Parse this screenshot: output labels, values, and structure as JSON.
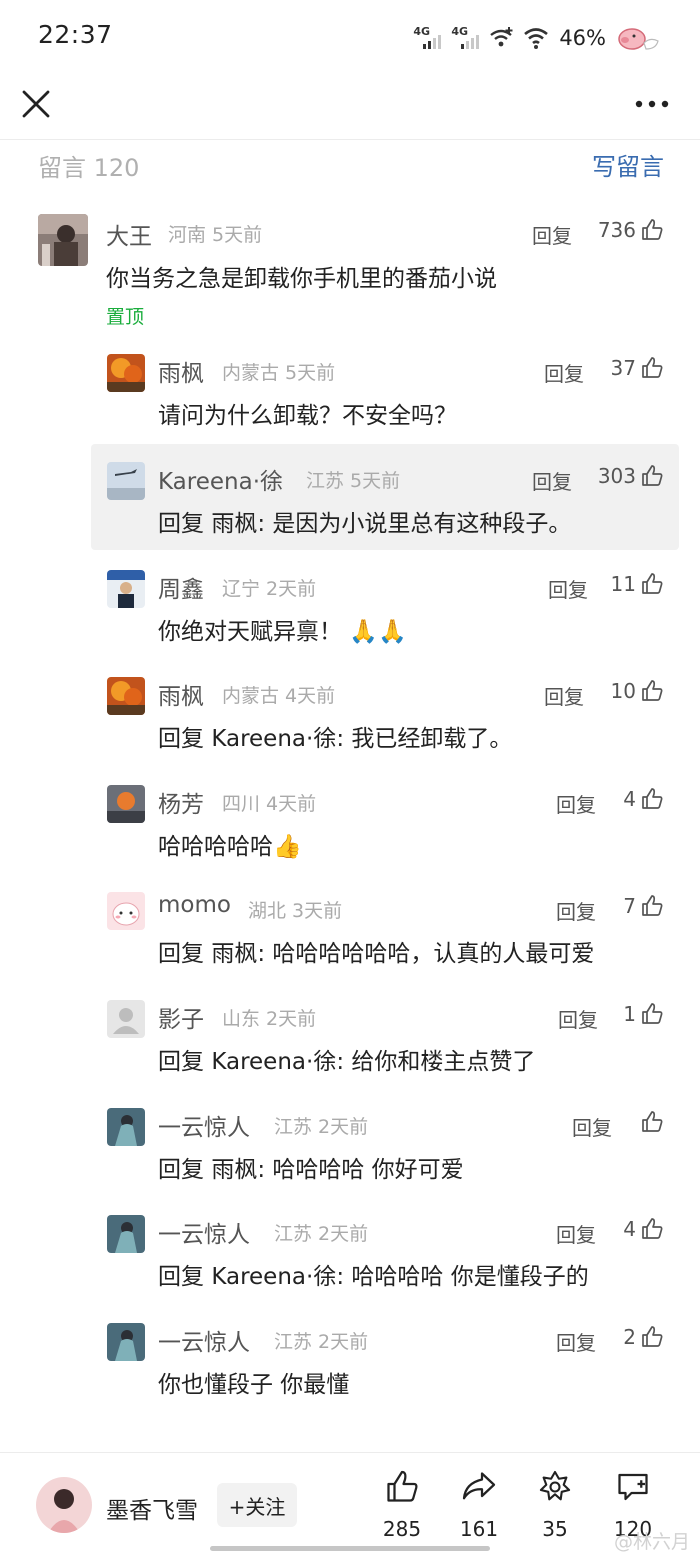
{
  "status_bar": {
    "time": "22:37",
    "signal1_label": "4G",
    "signal2_label": "4G",
    "battery": "46%",
    "icons": [
      "signal-4g-icon",
      "signal-4g-icon",
      "wifi-plus-icon",
      "wifi-icon",
      "pig-cloud-icon"
    ]
  },
  "nav": {
    "close_icon": "close-icon",
    "more_icon": "more-dots-icon"
  },
  "comments_header": {
    "count_label": "留言 120",
    "write_label": "写留言",
    "accent": "#3a6cb0"
  },
  "comments": [
    {
      "name": "大王",
      "meta": "河南 5天前",
      "reply": "回复",
      "likes": "736",
      "text": "你当务之急是卸载你手机里的番茄小说",
      "pinned": "置顶"
    },
    {
      "name": "雨枫",
      "meta": "内蒙古 5天前",
      "reply": "回复",
      "likes": "37",
      "text": "请问为什么卸载？不安全吗？"
    },
    {
      "name": "Kareena·徐",
      "meta": "江苏 5天前",
      "reply": "回复",
      "likes": "303",
      "reply_prefix": "回复",
      "reply_to": "雨枫:",
      "text": "是因为小说里总有这种段子。"
    },
    {
      "name": "周鑫",
      "meta": "辽宁 2天前",
      "reply": "回复",
      "likes": "11",
      "text": "你绝对天赋异禀！",
      "emoji": "🙏🙏"
    },
    {
      "name": "雨枫",
      "meta": "内蒙古 4天前",
      "reply": "回复",
      "likes": "10",
      "reply_prefix": "回复",
      "reply_to": "Kareena·徐:",
      "text": "我已经卸载了。"
    },
    {
      "name": "杨芳",
      "meta": "四川 4天前",
      "reply": "回复",
      "likes": "4",
      "text": "哈哈哈哈哈",
      "emoji": "👍"
    },
    {
      "name": "momo",
      "meta": "湖北 3天前",
      "reply": "回复",
      "likes": "7",
      "reply_prefix": "回复",
      "reply_to": "雨枫:",
      "text": "哈哈哈哈哈哈，认真的人最可爱"
    },
    {
      "name": "影子",
      "meta": "山东 2天前",
      "reply": "回复",
      "likes": "1",
      "reply_prefix": "回复",
      "reply_to": "Kareena·徐:",
      "text": "给你和楼主点赞了"
    },
    {
      "name": "一云惊人",
      "meta": "江苏 2天前",
      "reply": "回复",
      "likes": "",
      "reply_prefix": "回复",
      "reply_to": "雨枫:",
      "text": "哈哈哈哈 你好可爱"
    },
    {
      "name": "一云惊人",
      "meta": "江苏 2天前",
      "reply": "回复",
      "likes": "4",
      "reply_prefix": "回复",
      "reply_to": "Kareena·徐:",
      "text": "哈哈哈哈 你是懂段子的"
    },
    {
      "name": "一云惊人",
      "meta": "江苏 2天前",
      "reply": "回复",
      "likes": "2",
      "text": "你也懂段子 你最懂"
    }
  ],
  "bottom_bar": {
    "author_name": "墨香飞雪",
    "follow_label": "+关注",
    "like_count": "285",
    "share_count": "161",
    "star_count": "35",
    "comment_count": "120"
  },
  "watermark": "@林六月",
  "colors": {
    "pinned_green": "#1aad3c",
    "highlight_bg": "#f1f1f1"
  }
}
